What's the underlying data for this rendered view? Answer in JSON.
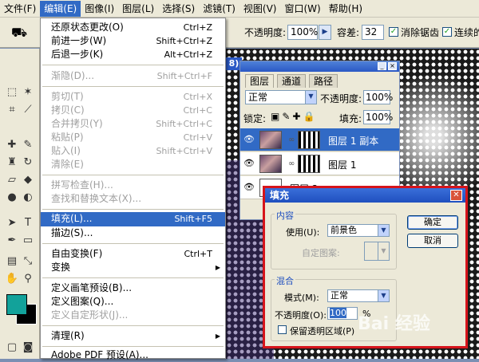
{
  "menubar": {
    "items": [
      "文件(F)",
      "编辑(E)",
      "图像(I)",
      "图层(L)",
      "选择(S)",
      "滤镜(T)",
      "视图(V)",
      "窗口(W)",
      "帮助(H)"
    ],
    "active_index": 1
  },
  "optionsbar": {
    "opacity_label": "不透明度:",
    "opacity_value": "100%",
    "tolerance_label": "容差:",
    "tolerance_value": "32",
    "antialias_label": "消除锯齿",
    "contiguous_label": "连续的"
  },
  "colors": {
    "foreground": "#12a29a",
    "background": "#000000",
    "highlight": "#316ac5",
    "dialog_border": "#d6141b"
  },
  "edit_menu": {
    "items": [
      {
        "label": "还原状态更改(O)",
        "shortcut": "Ctrl+Z",
        "disabled": false
      },
      {
        "label": "前进一步(W)",
        "shortcut": "Shift+Ctrl+Z",
        "disabled": false
      },
      {
        "label": "后退一步(K)",
        "shortcut": "Alt+Ctrl+Z",
        "disabled": false
      },
      {
        "label": "渐隐(D)...",
        "shortcut": "Shift+Ctrl+F",
        "disabled": true
      },
      {
        "label": "剪切(T)",
        "shortcut": "Ctrl+X",
        "disabled": true
      },
      {
        "label": "拷贝(C)",
        "shortcut": "Ctrl+C",
        "disabled": true
      },
      {
        "label": "合并拷贝(Y)",
        "shortcut": "Shift+Ctrl+C",
        "disabled": true
      },
      {
        "label": "粘贴(P)",
        "shortcut": "Ctrl+V",
        "disabled": true
      },
      {
        "label": "贴入(I)",
        "shortcut": "Shift+Ctrl+V",
        "disabled": true
      },
      {
        "label": "清除(E)",
        "shortcut": "",
        "disabled": true
      },
      {
        "label": "拼写检查(H)...",
        "shortcut": "",
        "disabled": true
      },
      {
        "label": "查找和替换文本(X)...",
        "shortcut": "",
        "disabled": true
      },
      {
        "label": "填充(L)...",
        "shortcut": "Shift+F5",
        "disabled": false,
        "highlighted": true
      },
      {
        "label": "描边(S)...",
        "shortcut": "",
        "disabled": false
      },
      {
        "label": "自由变换(F)",
        "shortcut": "Ctrl+T",
        "disabled": false
      },
      {
        "label": "变换",
        "shortcut": "",
        "disabled": false,
        "submenu": true
      },
      {
        "label": "定义画笔预设(B)...",
        "shortcut": "",
        "disabled": false
      },
      {
        "label": "定义图案(Q)...",
        "shortcut": "",
        "disabled": false
      },
      {
        "label": "定义自定形状(J)...",
        "shortcut": "",
        "disabled": true
      },
      {
        "label": "清理(R)",
        "shortcut": "",
        "disabled": false,
        "submenu": true
      },
      {
        "label": "Adobe PDF 预设(A)...",
        "shortcut": "",
        "disabled": false
      }
    ]
  },
  "layers_panel": {
    "tabs": [
      "图层",
      "通道",
      "路径"
    ],
    "blend_mode": "正常",
    "opacity_label": "不透明度:",
    "opacity_value": "100%",
    "lock_label": "锁定:",
    "fill_label": "填充:",
    "fill_value": "100%",
    "layers": [
      {
        "name": "图层 1 副本",
        "selected": true
      },
      {
        "name": "图层 1",
        "selected": false
      },
      {
        "name": "图层 2",
        "selected": false
      }
    ]
  },
  "doc_tab_fragment": "8)",
  "fill_dialog": {
    "title": "填充",
    "content_group": "内容",
    "use_label": "使用(U):",
    "use_value": "前景色",
    "pattern_label": "自定图案:",
    "blend_group": "混合",
    "mode_label": "模式(M):",
    "mode_value": "正常",
    "opacity_label": "不透明度(O):",
    "opacity_value": "100",
    "percent": "%",
    "preserve_label": "保留透明区域(P)",
    "ok_label": "确定",
    "cancel_label": "取消"
  },
  "watermark": "Bai 经验"
}
